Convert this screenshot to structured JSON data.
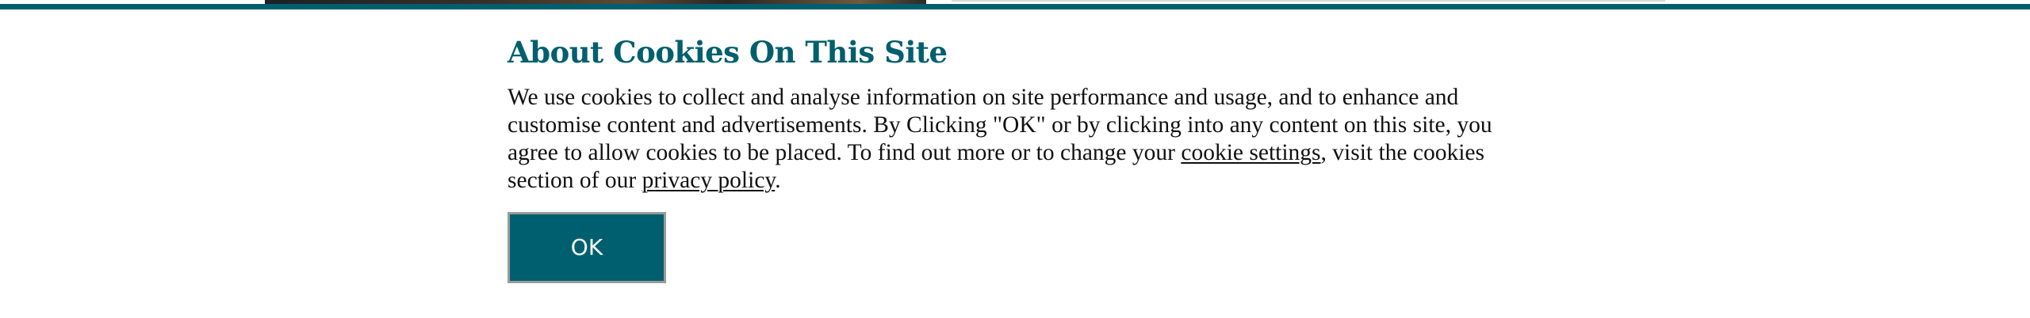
{
  "cookie_banner": {
    "title": "About Cookies On This Site",
    "text_part1": "We use cookies to collect and analyse information on site performance and usage, and to enhance and customise content and advertisements. By Clicking \"OK\" or by clicking into any content on this site, you agree to allow cookies to be placed. To find out more or to change your ",
    "cookie_settings_link": "cookie settings",
    "text_part2": ", visit the cookies section of our ",
    "privacy_policy_link": "privacy policy",
    "text_part3": ".",
    "ok_button_label": "OK"
  },
  "colors": {
    "accent": "#005f6e",
    "button_border": "#9a9a9a",
    "body_text": "#111111",
    "background": "#ffffff"
  }
}
